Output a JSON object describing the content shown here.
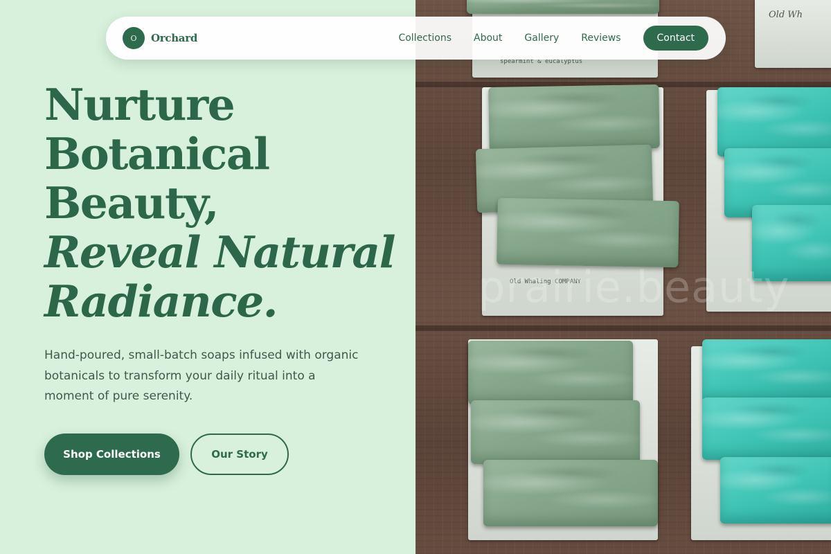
{
  "brand": {
    "initial": "O",
    "name": "Orchard"
  },
  "nav": {
    "links": [
      "Collections",
      "About",
      "Gallery",
      "Reviews"
    ],
    "contact_label": "Contact"
  },
  "hero": {
    "line1": "Nurture",
    "line2": "Botanical",
    "line3": "Beauty,",
    "line4": "Reveal Natural",
    "line5": "Radiance.",
    "subtitle": "Hand-poured, small-batch soaps infused with organic botanicals to transform your daily ritual into a moment of pure serenity.",
    "primary_cta": "Shop Collections",
    "secondary_cta": "Our Story"
  },
  "photo": {
    "watermark": "prairie.beauty",
    "label_texts": [
      "spearmint & eucalyptus",
      "Old Whaling COMPANY"
    ]
  },
  "colors": {
    "background": "#d8f1dc",
    "brand_green": "#2e6a4c",
    "heading_green": "#2b6748",
    "body_text": "#43574d"
  }
}
